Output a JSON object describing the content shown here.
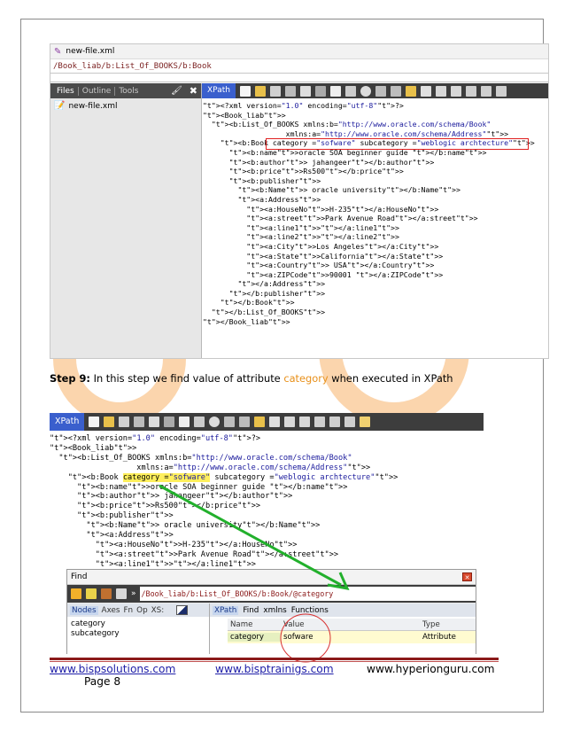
{
  "window": {
    "title": "new-file.xml",
    "path": "/Book_liab/b:List_Of_BOOKS/b:Book"
  },
  "left_panel": {
    "tabs": [
      "Files",
      "Outline",
      "Tools"
    ],
    "file": "new-file.xml"
  },
  "xpath_label": "XPath",
  "xml_lines_1": [
    "<?xml version=\"1.0\" encoding=\"utf-8\"?>",
    "<Book_liab>",
    "  <b:List_Of_BOOKS xmlns:b=\"http://www.oracle.com/schema/Book\"",
    "                   xmlns:a=\"http://www.oracle.com/schema/Address\">",
    "    <b:Book category =\"sofware\" subcategory =\"weblogic archtecture\">",
    "      <b:name>oracle SOA beginner guide </b:name>",
    "      <b:author> jahangeer</b:author>",
    "      <b:price>Rs500</b:price>",
    "      <b:publisher>",
    "        <b:Name> oracle university</b:Name>",
    "        <a:Address>",
    "          <a:HouseNo>H-235</a:HouseNo>",
    "          <a:street>Park Avenue Road</a:street>",
    "          <a:line1></a:line1>",
    "          <a:line2></a:line2>",
    "          <a:City>Los Angeles</a:City>",
    "          <a:State>California</a:State>",
    "          <a:Country> USA</a:Country>",
    "          <a:ZIPCode>90001 </a:ZIPCode>",
    "        </a:Address>",
    "",
    "      </b:publisher>",
    "    </b:Book>",
    "",
    "  </b:List_Of_BOOKS>",
    "",
    "</Book_liab>"
  ],
  "step": {
    "label": "Step 9:",
    "text_before": " In this step we  find value of attribute ",
    "keyword": "category",
    "text_after": " when executed in XPath"
  },
  "xml_lines_2": [
    "<?xml version=\"1.0\" encoding=\"utf-8\"?>",
    "<Book_liab>",
    "  <b:List_Of_BOOKS xmlns:b=\"http://www.oracle.com/schema/Book\"",
    "                   xmlns:a=\"http://www.oracle.com/schema/Address\">",
    "    <b:Book category =\"sofware\" subcategory =\"weblogic archtecture\">",
    "      <b:name>oracle SOA beginner guide </b:name>",
    "      <b:author> jahangeer</b:author>",
    "      <b:price>Rs500</b:price>",
    "      <b:publisher>",
    "        <b:Name> oracle university</b:Name>",
    "        <a:Address>",
    "          <a:HouseNo>H-235</a:HouseNo>",
    "          <a:street>Park Avenue Road</a:street>",
    "          <a:line1></a:line1>"
  ],
  "find": {
    "title": "Find",
    "xpath": "/Book_liab/b:List_Of_BOOKS/b:Book/@category",
    "left_tabs": [
      "Nodes",
      "Axes",
      "Fn",
      "Op",
      "XS:"
    ],
    "nodes": [
      "category",
      "subcategory"
    ],
    "right_tabs": [
      "XPath",
      "Find",
      "xmlns",
      "Functions"
    ],
    "columns": [
      "Name",
      "Value",
      "Type"
    ],
    "result": {
      "name": "category",
      "value": "sofware",
      "type": "Attribute"
    }
  },
  "footer": {
    "link1": "www.bispsolutions.com",
    "link2": "www.bisptrainigs.com",
    "site3": "www.hyperionguru.com",
    "page": "Page 8"
  },
  "colors": {
    "accent": "#8b1a1a",
    "link": "#1f1fa8",
    "highlight": "#ffef5c",
    "arrow": "#22b02c",
    "xpath_tab": "#3a5fcd"
  }
}
